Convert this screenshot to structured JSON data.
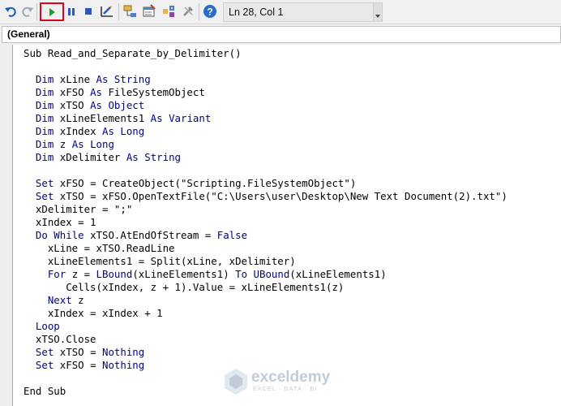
{
  "toolbar": {
    "icons": [
      "undo-icon",
      "redo-icon",
      "run-icon",
      "break-icon",
      "reset-icon",
      "design-mode-icon",
      "project-explorer-icon",
      "properties-window-icon",
      "object-browser-icon",
      "toolbox-icon",
      "help-icon"
    ],
    "status": "Ln 28, Col 1",
    "highlight_color": "#e4001b"
  },
  "object_box": {
    "value": "(General)"
  },
  "code": {
    "keyword_color": "#00008b",
    "lines": [
      [
        {
          "t": "Sub Read_and_Separate_by_Delimiter()"
        }
      ],
      [],
      [
        {
          "t": "  "
        },
        {
          "t": "Dim",
          "k": 1
        },
        {
          "t": " xLine "
        },
        {
          "t": "As",
          "k": 1
        },
        {
          "t": " "
        },
        {
          "t": "String",
          "k": 1
        }
      ],
      [
        {
          "t": "  "
        },
        {
          "t": "Dim",
          "k": 1
        },
        {
          "t": " xFSO "
        },
        {
          "t": "As",
          "k": 1
        },
        {
          "t": " FileSystemObject"
        }
      ],
      [
        {
          "t": "  "
        },
        {
          "t": "Dim",
          "k": 1
        },
        {
          "t": " xTSO "
        },
        {
          "t": "As",
          "k": 1
        },
        {
          "t": " "
        },
        {
          "t": "Object",
          "k": 1
        }
      ],
      [
        {
          "t": "  "
        },
        {
          "t": "Dim",
          "k": 1
        },
        {
          "t": " xLineElements1 "
        },
        {
          "t": "As",
          "k": 1
        },
        {
          "t": " "
        },
        {
          "t": "Variant",
          "k": 1
        }
      ],
      [
        {
          "t": "  "
        },
        {
          "t": "Dim",
          "k": 1
        },
        {
          "t": " xIndex "
        },
        {
          "t": "As",
          "k": 1
        },
        {
          "t": " "
        },
        {
          "t": "Long",
          "k": 1
        }
      ],
      [
        {
          "t": "  "
        },
        {
          "t": "Dim",
          "k": 1
        },
        {
          "t": " z "
        },
        {
          "t": "As",
          "k": 1
        },
        {
          "t": " "
        },
        {
          "t": "Long",
          "k": 1
        }
      ],
      [
        {
          "t": "  "
        },
        {
          "t": "Dim",
          "k": 1
        },
        {
          "t": " xDelimiter "
        },
        {
          "t": "As",
          "k": 1
        },
        {
          "t": " "
        },
        {
          "t": "String",
          "k": 1
        }
      ],
      [],
      [
        {
          "t": "  "
        },
        {
          "t": "Set",
          "k": 1
        },
        {
          "t": " xFSO = CreateObject(\"Scripting.FileSystemObject\")"
        }
      ],
      [
        {
          "t": "  "
        },
        {
          "t": "Set",
          "k": 1
        },
        {
          "t": " xTSO = xFSO.OpenTextFile(\"C:\\Users\\user\\Desktop\\New Text Document(2).txt\")"
        }
      ],
      [
        {
          "t": "  xDelimiter = \";\""
        }
      ],
      [
        {
          "t": "  xIndex = 1"
        }
      ],
      [
        {
          "t": "  "
        },
        {
          "t": "Do While",
          "k": 1
        },
        {
          "t": " xTSO.AtEndOfStream = "
        },
        {
          "t": "False",
          "k": 1
        }
      ],
      [
        {
          "t": "    xLine = xTSO.ReadLine"
        }
      ],
      [
        {
          "t": "    xLineElements1 = Split(xLine, xDelimiter)"
        }
      ],
      [
        {
          "t": "    "
        },
        {
          "t": "For",
          "k": 1
        },
        {
          "t": " z = "
        },
        {
          "t": "LBound",
          "k": 1
        },
        {
          "t": "(xLineElements1) "
        },
        {
          "t": "To",
          "k": 1
        },
        {
          "t": " "
        },
        {
          "t": "UBound",
          "k": 1
        },
        {
          "t": "(xLineElements1)"
        }
      ],
      [
        {
          "t": "       Cells(xIndex, z + 1).Value = xLineElements1(z)"
        }
      ],
      [
        {
          "t": "    "
        },
        {
          "t": "Next",
          "k": 1
        },
        {
          "t": " z"
        }
      ],
      [
        {
          "t": "    xIndex = xIndex + 1"
        }
      ],
      [
        {
          "t": "  "
        },
        {
          "t": "Loop",
          "k": 1
        }
      ],
      [
        {
          "t": "  xTSO.Close"
        }
      ],
      [
        {
          "t": "  "
        },
        {
          "t": "Set",
          "k": 1
        },
        {
          "t": " xTSO = "
        },
        {
          "t": "Nothing",
          "k": 1
        }
      ],
      [
        {
          "t": "  "
        },
        {
          "t": "Set",
          "k": 1
        },
        {
          "t": " xFSO = "
        },
        {
          "t": "Nothing",
          "k": 1
        }
      ],
      [],
      [
        {
          "t": "End Sub"
        }
      ]
    ]
  },
  "watermark": {
    "name": "exceldemy",
    "tagline": "EXCEL · DATA · BI"
  }
}
